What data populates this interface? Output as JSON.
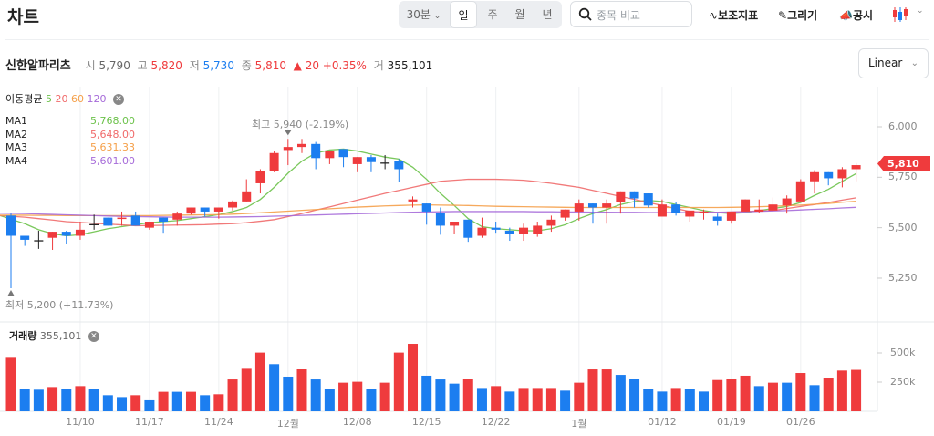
{
  "header": {
    "title": "차트",
    "interval": "30분",
    "periods": [
      "일",
      "주",
      "월",
      "년"
    ],
    "selected_period": "일",
    "search_placeholder": "종목 비교",
    "tools": [
      "보조지표",
      "그리기",
      "공시"
    ],
    "chart_type_icon": "candlestick-icon"
  },
  "info": {
    "name": "신한알파리츠",
    "open_label": "시",
    "open": "5,790",
    "high_label": "고",
    "high": "5,820",
    "low_label": "저",
    "low": "5,730",
    "close_label": "종",
    "close": "5,810",
    "change": "▲ 20 +0.35%",
    "volume_label": "거",
    "volume": "355,101"
  },
  "scale": "Linear",
  "legend": {
    "title": "이동평균",
    "periods": [
      "5",
      "20",
      "60",
      "120"
    ],
    "ma": [
      {
        "label": "MA1",
        "value": "5,768.00",
        "color": "#6cc24a"
      },
      {
        "label": "MA2",
        "value": "5,648.00",
        "color": "#f06a6a"
      },
      {
        "label": "MA3",
        "value": "5,631.33",
        "color": "#f5a04a"
      },
      {
        "label": "MA4",
        "value": "5,601.00",
        "color": "#a66bd9"
      }
    ]
  },
  "annotations": {
    "high": "최고  5,940 (-2.19%)",
    "low": "최저  5,200 (+11.73%)",
    "last_price": "5,810"
  },
  "volume_legend": {
    "title": "거래량",
    "value": "355,101"
  },
  "colors": {
    "up": "#ef3b3d",
    "down": "#1c7ef0",
    "doji": "#222222"
  },
  "chart_data": {
    "type": "candlestick",
    "price_axis": {
      "ticks": [
        "6,000",
        "5,750",
        "5,500",
        "5,250"
      ],
      "tick_values": [
        6000,
        5750,
        5500,
        5250
      ],
      "scale": "linear"
    },
    "volume_axis": {
      "ticks": [
        "500k",
        "250k"
      ],
      "tick_values": [
        500000,
        250000
      ]
    },
    "x_ticks": [
      {
        "label": "11/10",
        "index": 5
      },
      {
        "label": "11/17",
        "index": 10
      },
      {
        "label": "11/24",
        "index": 15
      },
      {
        "label": "12월",
        "index": 20
      },
      {
        "label": "12/08",
        "index": 25
      },
      {
        "label": "12/15",
        "index": 30
      },
      {
        "label": "12/22",
        "index": 35
      },
      {
        "label": "1월",
        "index": 41
      },
      {
        "label": "01/12",
        "index": 47
      },
      {
        "label": "01/19",
        "index": 52
      },
      {
        "label": "01/26",
        "index": 57
      }
    ],
    "ohlc": [
      [
        5560,
        5570,
        5200,
        5460
      ],
      [
        5460,
        5460,
        5410,
        5440
      ],
      [
        5435,
        5485,
        5395,
        5435
      ],
      [
        5450,
        5480,
        5390,
        5480
      ],
      [
        5480,
        5485,
        5420,
        5460
      ],
      [
        5460,
        5530,
        5440,
        5490
      ],
      [
        5515,
        5565,
        5490,
        5515
      ],
      [
        5550,
        5550,
        5510,
        5510
      ],
      [
        5545,
        5580,
        5510,
        5550
      ],
      [
        5560,
        5580,
        5510,
        5510
      ],
      [
        5500,
        5530,
        5490,
        5530
      ],
      [
        5550,
        5550,
        5475,
        5530
      ],
      [
        5540,
        5580,
        5510,
        5570
      ],
      [
        5570,
        5600,
        5565,
        5600
      ],
      [
        5600,
        5600,
        5555,
        5580
      ],
      [
        5580,
        5600,
        5545,
        5600
      ],
      [
        5600,
        5635,
        5585,
        5630
      ],
      [
        5630,
        5740,
        5630,
        5680
      ],
      [
        5720,
        5790,
        5670,
        5780
      ],
      [
        5780,
        5880,
        5775,
        5870
      ],
      [
        5885,
        5940,
        5810,
        5900
      ],
      [
        5900,
        5940,
        5870,
        5915
      ],
      [
        5915,
        5925,
        5790,
        5845
      ],
      [
        5845,
        5880,
        5815,
        5880
      ],
      [
        5890,
        5890,
        5800,
        5850
      ],
      [
        5815,
        5850,
        5775,
        5850
      ],
      [
        5850,
        5860,
        5775,
        5825
      ],
      [
        5820,
        5860,
        5790,
        5820
      ],
      [
        5830,
        5840,
        5725,
        5790
      ],
      [
        5630,
        5655,
        5600,
        5640
      ],
      [
        5620,
        5620,
        5515,
        5580
      ],
      [
        5575,
        5600,
        5465,
        5510
      ],
      [
        5510,
        5530,
        5470,
        5530
      ],
      [
        5540,
        5540,
        5430,
        5450
      ],
      [
        5460,
        5550,
        5450,
        5500
      ],
      [
        5500,
        5530,
        5475,
        5490
      ],
      [
        5485,
        5500,
        5435,
        5470
      ],
      [
        5470,
        5520,
        5435,
        5500
      ],
      [
        5470,
        5530,
        5455,
        5510
      ],
      [
        5510,
        5560,
        5480,
        5540
      ],
      [
        5550,
        5590,
        5535,
        5590
      ],
      [
        5580,
        5640,
        5535,
        5620
      ],
      [
        5620,
        5620,
        5520,
        5600
      ],
      [
        5600,
        5640,
        5520,
        5620
      ],
      [
        5625,
        5680,
        5570,
        5680
      ],
      [
        5680,
        5680,
        5600,
        5645
      ],
      [
        5670,
        5670,
        5600,
        5610
      ],
      [
        5555,
        5640,
        5555,
        5615
      ],
      [
        5615,
        5625,
        5560,
        5575
      ],
      [
        5555,
        5585,
        5530,
        5585
      ],
      [
        5575,
        5590,
        5540,
        5580
      ],
      [
        5555,
        5570,
        5510,
        5535
      ],
      [
        5535,
        5580,
        5520,
        5580
      ],
      [
        5580,
        5640,
        5580,
        5640
      ],
      [
        5580,
        5640,
        5575,
        5590
      ],
      [
        5585,
        5650,
        5585,
        5615
      ],
      [
        5610,
        5660,
        5570,
        5645
      ],
      [
        5630,
        5740,
        5630,
        5730
      ],
      [
        5730,
        5785,
        5670,
        5775
      ],
      [
        5775,
        5775,
        5710,
        5745
      ],
      [
        5745,
        5800,
        5700,
        5790
      ],
      [
        5790,
        5820,
        5730,
        5810
      ]
    ],
    "volume": [
      466000,
      193000,
      185000,
      208000,
      193000,
      216000,
      193000,
      138000,
      122000,
      138000,
      102000,
      167000,
      167000,
      167000,
      138000,
      146000,
      273000,
      372000,
      503000,
      404000,
      297000,
      365000,
      273000,
      193000,
      245000,
      253000,
      193000,
      245000,
      503000,
      578000,
      305000,
      273000,
      237000,
      281000,
      200000,
      216000,
      169000,
      200000,
      200000,
      200000,
      177000,
      245000,
      359000,
      359000,
      312000,
      281000,
      193000,
      169000,
      200000,
      193000,
      169000,
      268000,
      281000,
      305000,
      216000,
      245000,
      245000,
      328000,
      224000,
      289000,
      349000,
      355101
    ],
    "volume_up": [
      1,
      0,
      0,
      1,
      0,
      1,
      0,
      0,
      0,
      1,
      0,
      1,
      0,
      1,
      0,
      1,
      1,
      1,
      1,
      0,
      0,
      1,
      0,
      0,
      1,
      1,
      0,
      1,
      1,
      1,
      0,
      0,
      0,
      1,
      0,
      1,
      0,
      1,
      1,
      1,
      0,
      1,
      1,
      1,
      0,
      0,
      0,
      0,
      1,
      0,
      0,
      1,
      1,
      1,
      0,
      1,
      0,
      1,
      0,
      1,
      1,
      1
    ],
    "ma_series": [
      {
        "name": "MA1",
        "period": 5,
        "color": "#6cc24a",
        "values": [
          5560,
          5520,
          5490,
          5470,
          5460,
          5465,
          5480,
          5495,
          5505,
          5515,
          5525,
          5530,
          5535,
          5545,
          5555,
          5565,
          5580,
          5600,
          5640,
          5700,
          5770,
          5830,
          5870,
          5885,
          5890,
          5880,
          5865,
          5850,
          5840,
          5800,
          5740,
          5670,
          5610,
          5545,
          5505,
          5495,
          5490,
          5485,
          5485,
          5495,
          5515,
          5545,
          5570,
          5590,
          5615,
          5630,
          5635,
          5630,
          5615,
          5600,
          5585,
          5575,
          5570,
          5575,
          5585,
          5595,
          5605,
          5625,
          5660,
          5690,
          5730,
          5768
        ]
      },
      {
        "name": "MA2",
        "period": 20,
        "color": "#f06a6a",
        "values": [
          5560,
          5552,
          5545,
          5538,
          5530,
          5526,
          5522,
          5518,
          5514,
          5510,
          5511,
          5512,
          5513,
          5514,
          5515,
          5518,
          5520,
          5525,
          5532,
          5540,
          5555,
          5570,
          5587,
          5603,
          5620,
          5637,
          5653,
          5670,
          5685,
          5700,
          5715,
          5730,
          5735,
          5740,
          5740,
          5740,
          5738,
          5735,
          5728,
          5720,
          5710,
          5700,
          5685,
          5670,
          5655,
          5640,
          5625,
          5610,
          5595,
          5580,
          5578,
          5575,
          5578,
          5580,
          5583,
          5585,
          5595,
          5605,
          5615,
          5625,
          5637,
          5648
        ]
      },
      {
        "name": "MA3",
        "period": 60,
        "color": "#f5a04a",
        "values": [
          5562,
          5562,
          5561,
          5561,
          5560,
          5560,
          5560,
          5560,
          5560,
          5560,
          5560,
          5561,
          5562,
          5563,
          5564,
          5565,
          5567,
          5570,
          5574,
          5578,
          5582,
          5586,
          5590,
          5594,
          5598,
          5602,
          5605,
          5608,
          5610,
          5612,
          5613,
          5612,
          5611,
          5610,
          5608,
          5606,
          5605,
          5604,
          5603,
          5602,
          5601,
          5600,
          5600,
          5600,
          5600,
          5600,
          5600,
          5600,
          5600,
          5600,
          5600,
          5600,
          5601,
          5602,
          5604,
          5606,
          5609,
          5612,
          5616,
          5620,
          5626,
          5631
        ]
      },
      {
        "name": "MA4",
        "period": 120,
        "color": "#a66bd9",
        "values": [
          5572,
          5570,
          5568,
          5566,
          5564,
          5562,
          5560,
          5558,
          5556,
          5555,
          5554,
          5553,
          5552,
          5552,
          5552,
          5552,
          5553,
          5554,
          5555,
          5557,
          5559,
          5561,
          5563,
          5565,
          5567,
          5569,
          5571,
          5573,
          5575,
          5577,
          5578,
          5579,
          5580,
          5580,
          5580,
          5580,
          5580,
          5580,
          5579,
          5579,
          5578,
          5578,
          5577,
          5577,
          5576,
          5576,
          5575,
          5575,
          5575,
          5575,
          5576,
          5577,
          5578,
          5579,
          5581,
          5583,
          5585,
          5588,
          5591,
          5594,
          5598,
          5601
        ]
      }
    ],
    "period_high": 5940,
    "period_low": 5200
  }
}
